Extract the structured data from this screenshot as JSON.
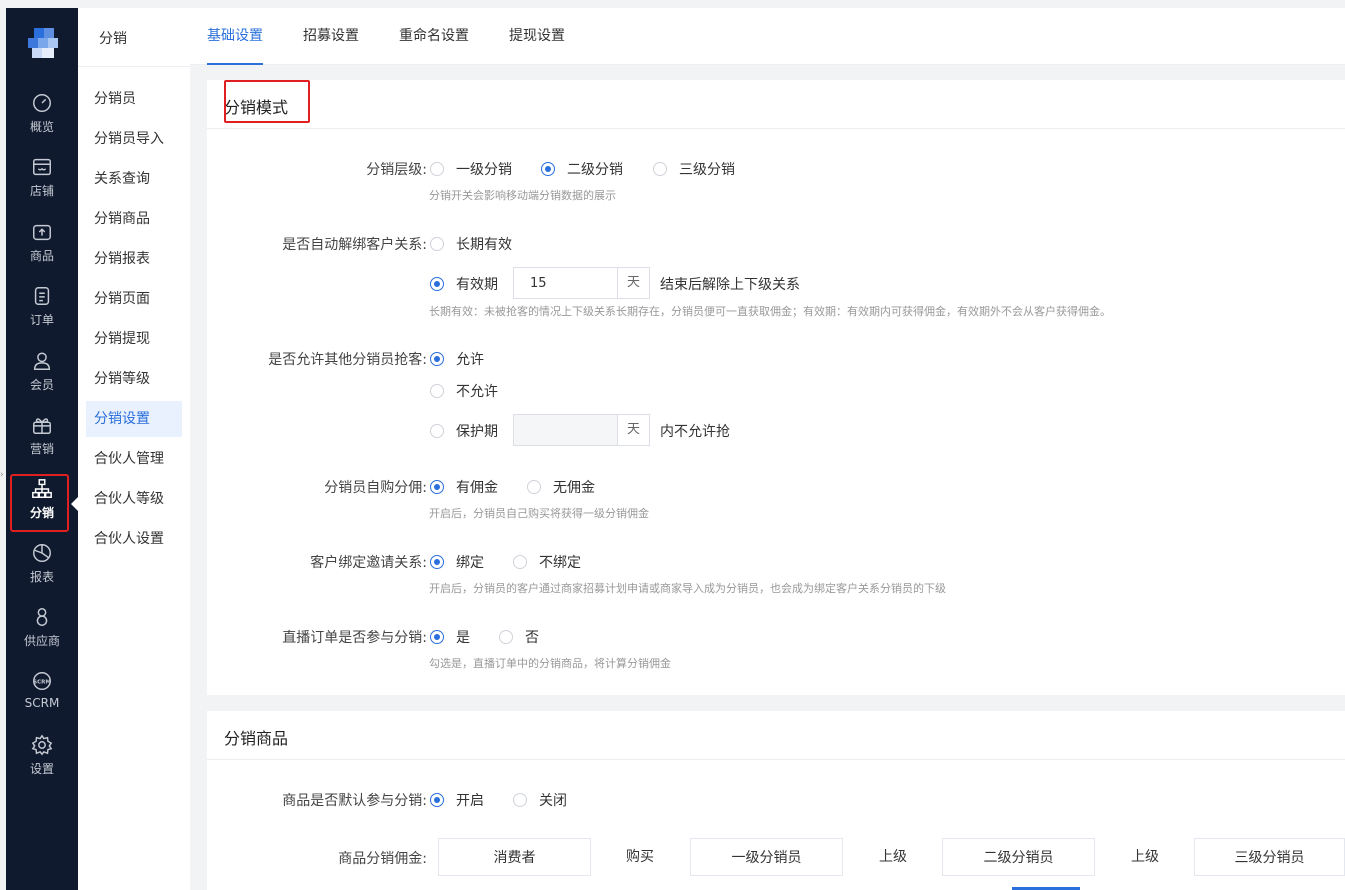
{
  "iconbar": {
    "items": [
      {
        "label": "概览",
        "icon": "dashboard-icon"
      },
      {
        "label": "店铺",
        "icon": "store-icon"
      },
      {
        "label": "商品",
        "icon": "product-icon"
      },
      {
        "label": "订单",
        "icon": "order-icon"
      },
      {
        "label": "会员",
        "icon": "member-icon"
      },
      {
        "label": "营销",
        "icon": "gift-icon"
      },
      {
        "label": "分销",
        "icon": "org-chart-icon"
      },
      {
        "label": "报表",
        "icon": "pie-chart-icon"
      },
      {
        "label": "供应商",
        "icon": "supplier-icon"
      },
      {
        "label": "SCRM",
        "icon": "scrm-icon"
      },
      {
        "label": "设置",
        "icon": "gear-icon"
      }
    ],
    "active": "分销"
  },
  "subnav": {
    "title": "分销",
    "items": [
      "分销员",
      "分销员导入",
      "关系查询",
      "分销商品",
      "分销报表",
      "分销页面",
      "分销提现",
      "分销等级",
      "分销设置",
      "合伙人管理",
      "合伙人等级",
      "合伙人设置"
    ],
    "active": "分销设置"
  },
  "tabs": [
    "基础设置",
    "招募设置",
    "重命名设置",
    "提现设置"
  ],
  "mode": {
    "title": "分销模式",
    "level": {
      "label": "分销层级:",
      "options": [
        "一级分销",
        "二级分销",
        "三级分销"
      ],
      "selected": "二级分销",
      "hint": "分销开关会影响移动端分销数据的展示"
    },
    "unbind": {
      "label": "是否自动解绑客户关系:",
      "option_long": "长期有效",
      "option_period": "有效期",
      "days_value": "15",
      "days_suffix": "天",
      "after_text": "结束后解除上下级关系",
      "selected": "有效期",
      "hint": "长期有效：未被抢客的情况上下级关系长期存在，分销员便可一直获取佣金；有效期：有效期内可获得佣金，有效期外不会从客户获得佣金。"
    },
    "grab": {
      "label": "是否允许其他分销员抢客:",
      "option_allow": "允许",
      "option_deny": "不允许",
      "option_protect": "保护期",
      "protect_suffix": "天",
      "protect_after": "内不允许抢",
      "selected": "允许"
    },
    "self_buy": {
      "label": "分销员自购分佣:",
      "options": [
        "有佣金",
        "无佣金"
      ],
      "selected": "有佣金",
      "hint": "开启后，分销员自己购买将获得一级分销佣金"
    },
    "bind_invite": {
      "label": "客户绑定邀请关系:",
      "options": [
        "绑定",
        "不绑定"
      ],
      "selected": "绑定",
      "hint": "开启后，分销员的客户通过商家招募计划申请或商家导入成为分销员，也会成为绑定客户关系分销员的下级"
    },
    "live": {
      "label": "直播订单是否参与分销:",
      "options": [
        "是",
        "否"
      ],
      "selected": "是",
      "hint": "勾选是，直播订单中的分销商品，将计算分销佣金"
    }
  },
  "products": {
    "title": "分销商品",
    "default_join": {
      "label": "商品是否默认参与分销:",
      "options": [
        "开启",
        "关闭"
      ],
      "selected": "开启"
    },
    "commission": {
      "label": "商品分销佣金:",
      "cells": [
        "消费者",
        "购买",
        "一级分销员",
        "上级",
        "二级分销员",
        "上级",
        "三级分销员"
      ]
    }
  },
  "colors": {
    "accent": "#2a6fdb",
    "sidebar_bg": "#0f1a2e",
    "highlight": "#e02020"
  }
}
